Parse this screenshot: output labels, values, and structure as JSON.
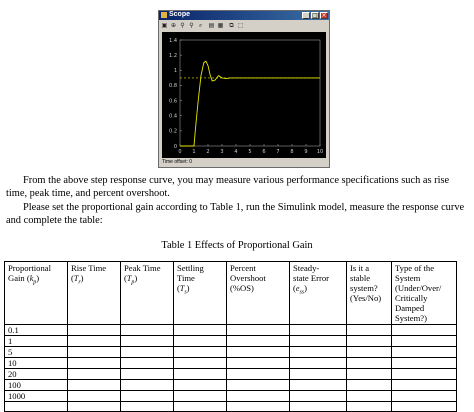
{
  "scope": {
    "title": "Scope",
    "status": "Time offset:  0",
    "toolbar_icons": [
      "print-icon",
      "zoom-in-icon",
      "zoom-x-icon",
      "zoom-y-icon",
      "autoscale-icon",
      "save-axes-icon",
      "parameters-icon",
      "float-icon",
      "select-icon"
    ],
    "colors": {
      "background": "#000000",
      "trace": "#e8e800",
      "reference": "#e8e800",
      "axis_text": "#cfcfcf"
    }
  },
  "chart_data": {
    "type": "line",
    "title": "",
    "xlabel": "",
    "ylabel": "",
    "xlim": [
      0,
      10
    ],
    "ylim": [
      0,
      1.4
    ],
    "x_ticks": [
      "0",
      "1",
      "2",
      "3",
      "4",
      "5",
      "6",
      "7",
      "8",
      "9",
      "10"
    ],
    "y_ticks": [
      "0",
      "0.2",
      "0.4",
      "0.6",
      "0.8",
      "1",
      "1.2",
      "1.4"
    ],
    "grid": false,
    "series": [
      {
        "x": [
          0,
          1.0,
          1.1,
          1.3,
          1.5,
          1.7,
          1.85,
          2.0,
          2.15,
          2.3,
          2.5,
          2.75,
          3.0,
          3.3,
          3.6,
          4.0,
          5.0,
          6.0,
          7.0,
          8.0,
          9.0,
          10.0
        ],
        "y": [
          0,
          0,
          0.22,
          0.6,
          0.93,
          1.1,
          1.12,
          1.06,
          0.94,
          0.86,
          0.87,
          0.93,
          0.9,
          0.89,
          0.9,
          0.9,
          0.9,
          0.9,
          0.9,
          0.9,
          0.9,
          0.9
        ]
      },
      {
        "x": [
          0,
          10
        ],
        "y": [
          0.9,
          0.9
        ],
        "style": "dashed"
      }
    ]
  },
  "text": {
    "para1": "From the above step response curve, you may measure various performance specifications such as rise time, peak time, and percent overshoot.",
    "para2": "Please set the proportional gain according to Table 1, run the Simulink model, measure the response curve and complete the table:",
    "caption": "Table 1   Effects of Proportional Gain"
  },
  "table": {
    "headers": [
      {
        "lines": [
          "Proportional",
          "Gain ("
        ],
        "symbol": "kp",
        "close": ")"
      },
      {
        "lines": [
          "Rise Time",
          "("
        ],
        "symbol": "Tr",
        "close": ")"
      },
      {
        "lines": [
          "Peak Time",
          "("
        ],
        "symbol": "Tp",
        "close": ")"
      },
      {
        "lines": [
          "Settling",
          "Time",
          "("
        ],
        "symbol": "Ts",
        "close": ")"
      },
      {
        "lines": [
          "Percent",
          "Overshoot",
          "(%OS)"
        ]
      },
      {
        "lines": [
          "Steady-",
          "state Error",
          "("
        ],
        "symbol": "ess",
        "close": ")"
      },
      {
        "lines": [
          "Is it a",
          "stable",
          "system?",
          "(Yes/No)"
        ]
      },
      {
        "lines": [
          "Type of the",
          "System",
          "(Under/Over/",
          "Critically",
          "Damped",
          "System?)"
        ]
      }
    ],
    "gains": [
      "0.1",
      "1",
      "5",
      "10",
      "20",
      "100",
      "1000"
    ]
  }
}
